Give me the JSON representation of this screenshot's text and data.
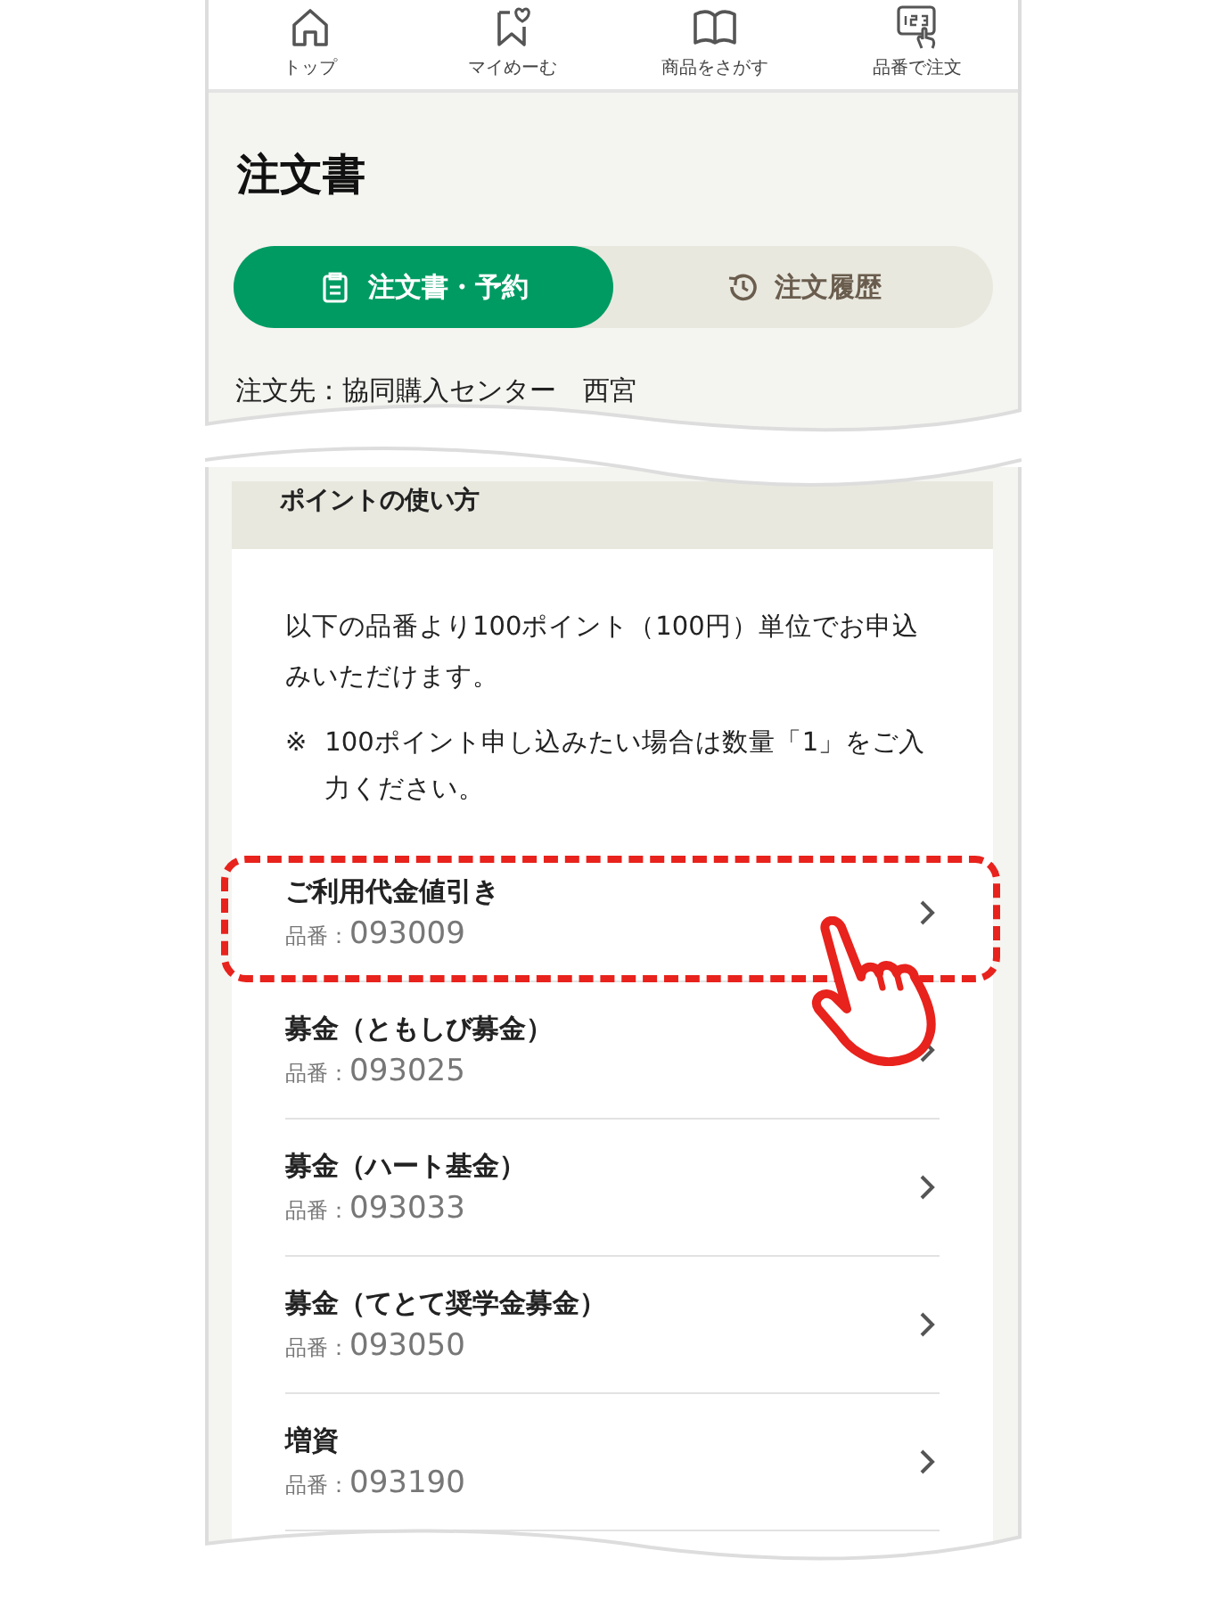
{
  "nav": [
    {
      "label": "トップ"
    },
    {
      "label": "マイめーむ"
    },
    {
      "label": "商品をさがす"
    },
    {
      "label": "品番で注文"
    }
  ],
  "title": "注文書",
  "tabs": [
    {
      "label": "注文書・予約",
      "selected": true
    },
    {
      "label": "注文履歴",
      "selected": false
    }
  ],
  "destination": "注文先：協同購入センター　西宮",
  "section": {
    "title": "ポイントの使い方",
    "description": "以下の品番より100ポイント（100円）単位でお申込みいただけます。",
    "note_mark": "※",
    "note": "100ポイント申し込みたい場合は数量「1」をご入力ください。"
  },
  "items": [
    {
      "name": "ご利用代金値引き",
      "prefix": "品番：",
      "code": "093009",
      "highlighted": true
    },
    {
      "name": "募金（ともしび募金）",
      "prefix": "品番：",
      "code": "093025",
      "highlighted": false
    },
    {
      "name": "募金（ハート基金）",
      "prefix": "品番：",
      "code": "093033",
      "highlighted": false
    },
    {
      "name": "募金（てとて奨学金募金）",
      "prefix": "品番：",
      "code": "093050",
      "highlighted": false
    },
    {
      "name": "増資",
      "prefix": "品番：",
      "code": "093190",
      "highlighted": false
    }
  ]
}
